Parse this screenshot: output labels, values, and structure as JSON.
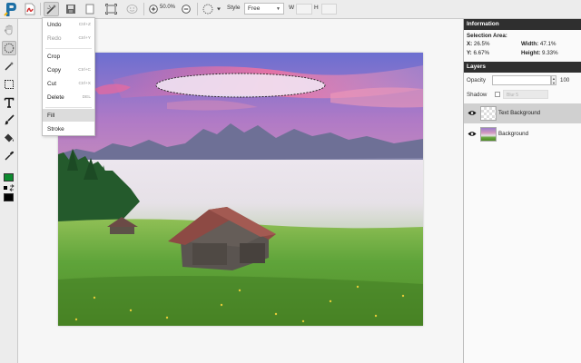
{
  "toolbar": {
    "zoom": "50.0%",
    "style_label": "Style",
    "style_value": "Free",
    "w_label": "W",
    "h_label": "H"
  },
  "edit_menu": {
    "items": [
      {
        "label": "Undo",
        "shortcut": "Ctrl+Z"
      },
      {
        "label": "Redo",
        "shortcut": "Ctrl+Y"
      },
      {
        "label": "Crop",
        "shortcut": ""
      },
      {
        "label": "Copy",
        "shortcut": "Ctrl+C"
      },
      {
        "label": "Cut",
        "shortcut": "Ctrl+X"
      },
      {
        "label": "Delete",
        "shortcut": "DEL"
      },
      {
        "label": "Fill",
        "shortcut": ""
      },
      {
        "label": "Stroke",
        "shortcut": ""
      }
    ]
  },
  "colors": {
    "foreground": "#0d8a2e",
    "background": "#000000",
    "panel_header": "#2f2f2f"
  },
  "information": {
    "title": "Information",
    "selection_label": "Selection Area:",
    "x_label": "X:",
    "x_value": "26.5%",
    "y_label": "Y:",
    "y_value": "6.67%",
    "width_label": "Width:",
    "width_value": "47.1%",
    "height_label": "Height:",
    "height_value": "9.33%"
  },
  "layers": {
    "title": "Layers",
    "opacity_label": "Opacity",
    "opacity_value": "100",
    "shadow_label": "Shadow",
    "blur_label": "Blur 5",
    "items": [
      {
        "name": "Text Background",
        "selected": true
      },
      {
        "name": "Background",
        "selected": false
      }
    ]
  }
}
